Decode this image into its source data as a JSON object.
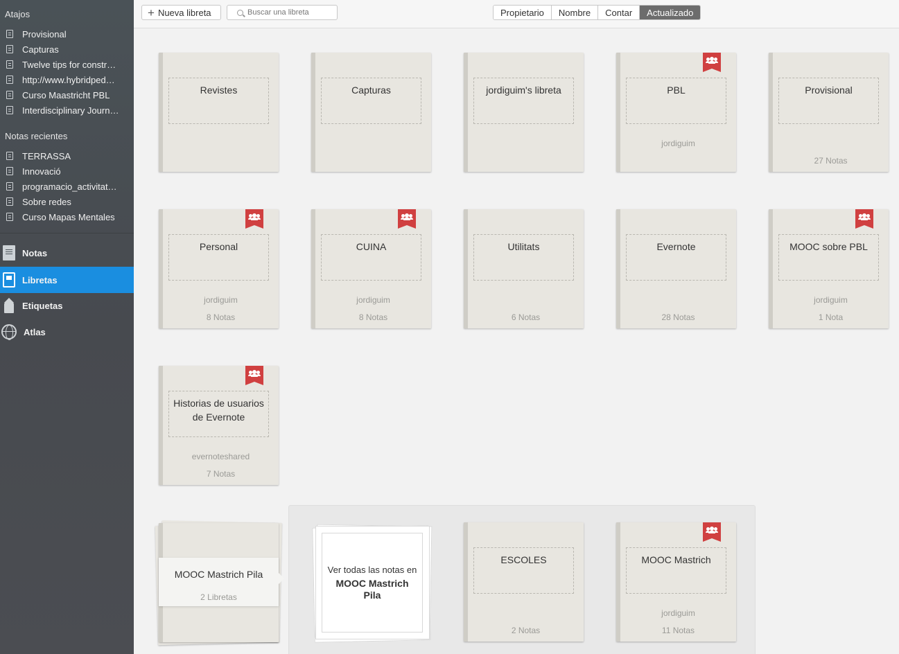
{
  "sidebar": {
    "shortcuts_heading": "Atajos",
    "shortcuts": [
      {
        "label": "Provisional"
      },
      {
        "label": "Capturas"
      },
      {
        "label": "Twelve tips for constr…"
      },
      {
        "label": "http://www.hybridped…"
      },
      {
        "label": "Curso Maastricht PBL"
      },
      {
        "label": "Interdisciplinary Journ…"
      }
    ],
    "recent_heading": "Notas recientes",
    "recent": [
      {
        "label": "TERRASSA"
      },
      {
        "label": "Innovació"
      },
      {
        "label": "programacio_activitat…"
      },
      {
        "label": "Sobre redes"
      },
      {
        "label": "Curso Mapas Mentales"
      }
    ],
    "nav": [
      {
        "label": "Notas",
        "icon": "notes-icon"
      },
      {
        "label": "Libretas",
        "icon": "notebook-icon",
        "active": true
      },
      {
        "label": "Etiquetas",
        "icon": "tag-icon"
      },
      {
        "label": "Atlas",
        "icon": "globe-icon"
      }
    ]
  },
  "toolbar": {
    "new_notebook_label": "Nueva libreta",
    "search_placeholder": "Buscar una libreta",
    "sort_options": [
      "Propietario",
      "Nombre",
      "Contar",
      "Actualizado"
    ],
    "active_sort": "Actualizado"
  },
  "notebooks": [
    {
      "title": "Revistes",
      "owner": "",
      "count": "",
      "shared": false
    },
    {
      "title": "Capturas",
      "owner": "",
      "count": "",
      "shared": false
    },
    {
      "title": "jordiguim's libreta",
      "owner": "",
      "count": "",
      "shared": false
    },
    {
      "title": "PBL",
      "owner": "jordiguim",
      "count": "",
      "shared": true
    },
    {
      "title": "Provisional",
      "owner": "",
      "count": "27 Notas",
      "shared": false
    },
    {
      "title": "Personal",
      "owner": "jordiguim",
      "count": "8 Notas",
      "shared": true
    },
    {
      "title": "CUINA",
      "owner": "jordiguim",
      "count": "8 Notas",
      "shared": true
    },
    {
      "title": "Utilitats",
      "owner": "",
      "count": "6 Notas",
      "shared": false
    },
    {
      "title": "Evernote",
      "owner": "",
      "count": "28 Notas",
      "shared": false
    },
    {
      "title": "MOOC sobre PBL",
      "owner": "jordiguim",
      "count": "1 Nota",
      "shared": true
    },
    {
      "title": "Historias de usuarios de Evernote",
      "owner": "evernoteshared",
      "count": "7 Notas",
      "shared": true
    }
  ],
  "stack": {
    "name": "MOOC Mastrich Pila",
    "count": "2 Libretas",
    "view_all_line1": "Ver todas las notas en",
    "view_all_line2": "MOOC Mastrich Pila",
    "notebooks": [
      {
        "title": "ESCOLES",
        "owner": "",
        "count": "2 Notas",
        "shared": false
      },
      {
        "title": "MOOC Mastrich",
        "owner": "jordiguim",
        "count": "11 Notas",
        "shared": true
      }
    ]
  },
  "colors": {
    "accent": "#1a8ee0",
    "shared_flag": "#d04040",
    "sidebar_bg": "#4a5257"
  }
}
